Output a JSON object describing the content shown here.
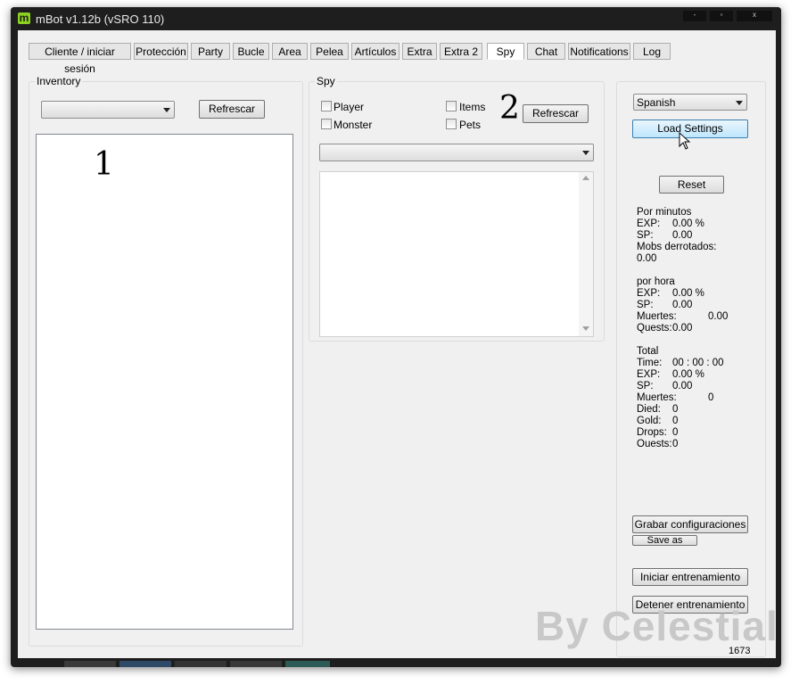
{
  "window": {
    "title": "mBot v1.12b (vSRO 110)",
    "icon": "m",
    "minimize": "-",
    "maximize": "▫",
    "close": "x"
  },
  "tabs": [
    {
      "label": "Cliente / iniciar sesión"
    },
    {
      "label": "Protección"
    },
    {
      "label": "Party"
    },
    {
      "label": "Bucle"
    },
    {
      "label": "Area"
    },
    {
      "label": "Pelea"
    },
    {
      "label": "Artículos"
    },
    {
      "label": "Extra"
    },
    {
      "label": "Extra 2"
    },
    {
      "label": "Spy",
      "active": true
    },
    {
      "label": "Chat"
    },
    {
      "label": "Notifications"
    },
    {
      "label": "Log"
    }
  ],
  "inventory": {
    "label": "Inventory",
    "select_value": "",
    "refresh": "Refrescar",
    "annotation": "1"
  },
  "spy": {
    "label": "Spy",
    "checkboxes": {
      "player": "Player",
      "monster": "Monster",
      "items": "Items",
      "pets": "Pets"
    },
    "annotation": "2",
    "refresh": "Refrescar",
    "select_value": ""
  },
  "right": {
    "language": "Spanish",
    "load_settings": "Load Settings",
    "reset": "Reset",
    "per_minute": {
      "header": "Por minutos",
      "exp_label": "EXP:",
      "exp_value": "0.00 %",
      "sp_label": "SP:",
      "sp_value": "0.00",
      "mobs_label": "Mobs derrotados:",
      "mobs_value": "0.00"
    },
    "per_hour": {
      "header": "por hora",
      "exp_label": "EXP:",
      "exp_value": "0.00 %",
      "sp_label": "SP:",
      "sp_value": "0.00",
      "deaths_label": "Muertes:",
      "deaths_value": "0.00",
      "quests_label": "Quests:",
      "quests_value": "0.00"
    },
    "total": {
      "header": "Total",
      "time_label": "Time:",
      "time_value": "00 : 00 : 00",
      "exp_label": "EXP:",
      "exp_value": "0.00 %",
      "sp_label": "SP:",
      "sp_value": "0.00",
      "deaths_label": "Muertes:",
      "deaths_value": "0",
      "died_label": "Died:",
      "died_value": "0",
      "gold_label": "Gold:",
      "gold_value": "0",
      "drops_label": "Drops:",
      "drops_value": "0",
      "quests_label": "Ouests:",
      "quests_value": "0"
    },
    "save_config": "Grabar configuraciones",
    "save_as": "Save as",
    "start": "Iniciar entrenamiento",
    "stop": "Detener entrenamiento"
  },
  "watermark": "By Celestial",
  "status_number": "1673",
  "colors": {
    "window_bg": "#f0f0f0",
    "frame": "#1e1e1e",
    "icon_green": "#8bd11f",
    "watermark": "#c8c8c8"
  }
}
